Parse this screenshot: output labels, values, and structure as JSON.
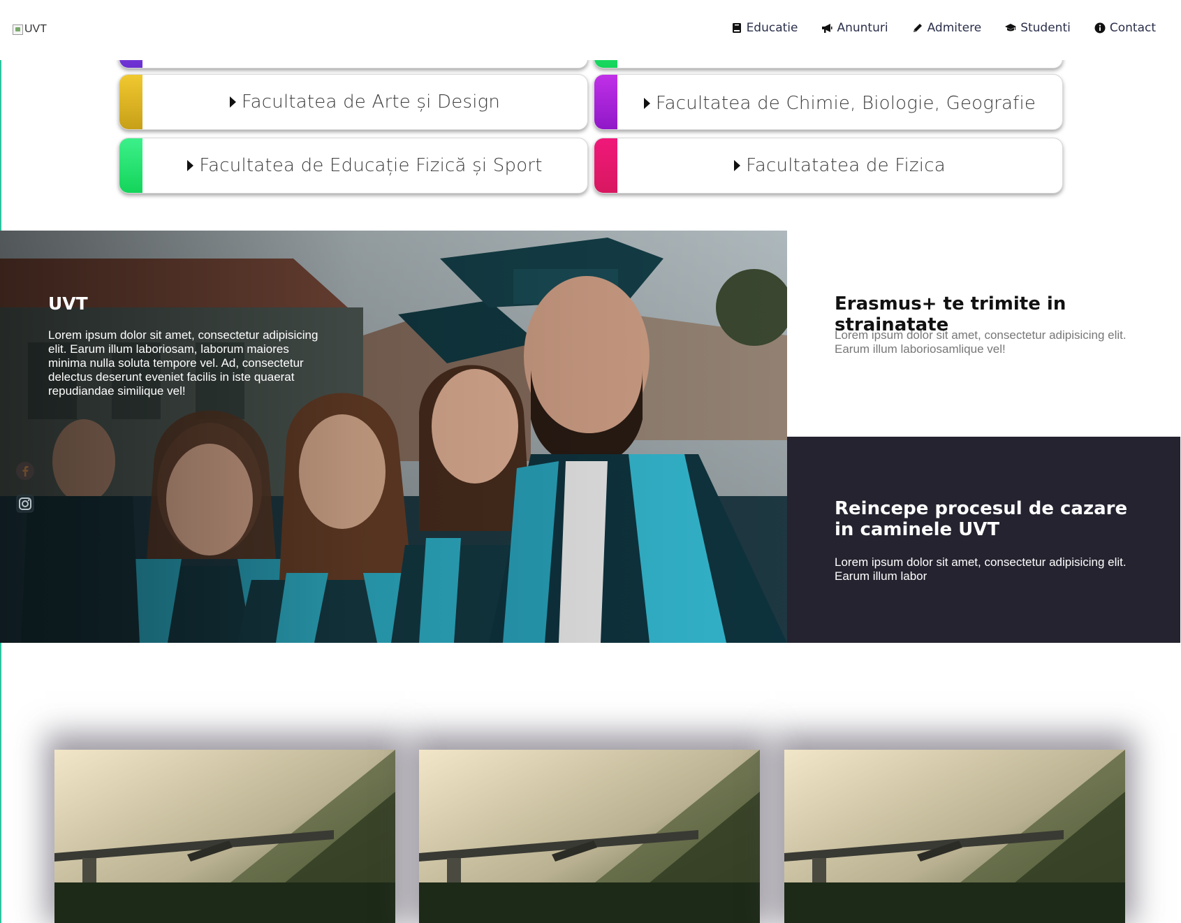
{
  "nav": {
    "logo_alt": "UVT",
    "items": [
      {
        "label": "Educatie",
        "icon": "book-icon"
      },
      {
        "label": "Anunturi",
        "icon": "megaphone-icon"
      },
      {
        "label": "Admitere",
        "icon": "pencil-icon"
      },
      {
        "label": "Studenti",
        "icon": "graduation-cap-icon"
      },
      {
        "label": "Contact",
        "icon": "info-circle-icon"
      }
    ]
  },
  "faculties": [
    {
      "label": "Facultatea de Arte și Design",
      "color": "#e0b820"
    },
    {
      "label": "Facultatea de Chimie, Biologie, Geografie",
      "color": "#b01fd8"
    },
    {
      "label": "Facultatea de Educație Fizică și Sport",
      "color": "#1ee66a"
    },
    {
      "label": "Facultatatea de Fizica",
      "color": "#e8186a"
    }
  ],
  "partial_cards_colors": [
    "#7a3fd8",
    "#1ee66a"
  ],
  "hero": {
    "title": "UVT",
    "text": "Lorem ipsum dolor sit amet, consectetur adipisicing elit. Earum illum laboriosam, laborum maiores minima nulla soluta tempore vel. Ad, consectetur delectus deserunt eveniet facilis in iste quaerat repudiandae similique vel!",
    "social_icons": [
      "facebook-icon",
      "instagram-icon"
    ]
  },
  "news": [
    {
      "title": "Erasmus+ te trimite in strainatate",
      "text": "Lorem ipsum dolor sit amet, consectetur adipisicing elit. Earum illum laboriosamlique vel!"
    },
    {
      "title": "Reincepe procesul de cazare in caminele UVT",
      "text": "Lorem ipsum dolor sit amet, consectetur adipisicing elit. Earum illum labor"
    }
  ],
  "colors": {
    "dark_panel": "#24232f",
    "accent_line": "#2ec4a0"
  }
}
